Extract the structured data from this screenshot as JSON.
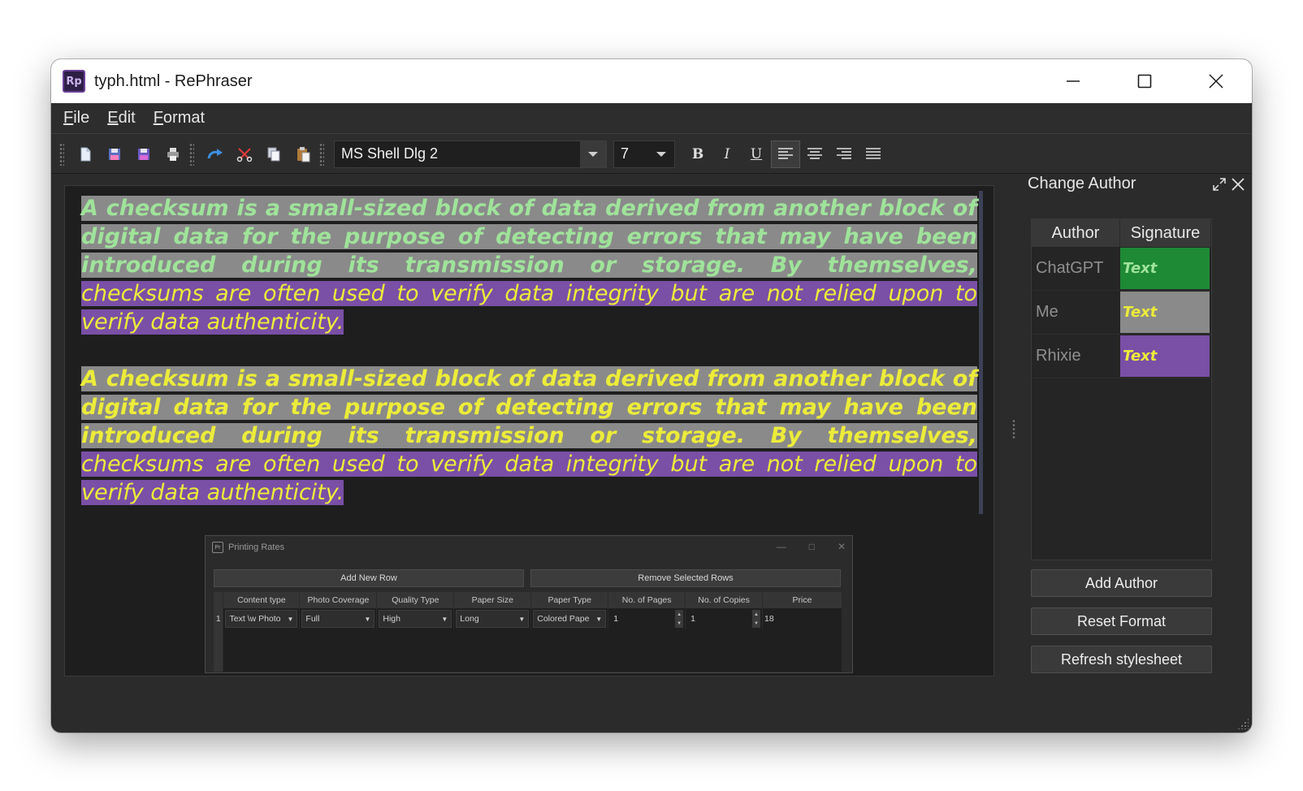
{
  "window": {
    "title": "typh.html - RePhraser",
    "app_icon": "Rp"
  },
  "menu": {
    "items": [
      {
        "mnemonic": "F",
        "rest": "ile"
      },
      {
        "mnemonic": "E",
        "rest": "dit"
      },
      {
        "mnemonic": "F",
        "rest": "ormat"
      }
    ]
  },
  "toolbar": {
    "font": "MS Shell Dlg 2",
    "size": "7",
    "bold": "B",
    "italic": "I",
    "underline": "U"
  },
  "document": {
    "paragraphs": [
      {
        "part_a": "A checksum is a small-sized block of data derived from another block of digital data for the purpose of detecting errors that may have been introduced during its transmission or storage. By themselves,",
        "part_b": "checksums are often used to verify data integrity but are not relied upon to verify data authenticity."
      },
      {
        "part_a": "A checksum is a small-sized block of data derived from another block of digital data for the purpose of detecting errors that may have been introduced during its transmission or storage. By themselves,",
        "part_b": "checksums are often used to verify data integrity but are not relied upon to verify data authenticity."
      }
    ]
  },
  "embedded": {
    "title": "Printing Rates",
    "icon": "Pr",
    "add_row": "Add New Row",
    "remove_rows": "Remove Selected Rows",
    "columns": [
      "Content type",
      "Photo Coverage",
      "Quality Type",
      "Paper Size",
      "Paper Type",
      "No. of Pages",
      "No. of Copies",
      "Price"
    ],
    "row": {
      "index": "1",
      "content_type": "Text \\w Photo",
      "photo_coverage": "Full",
      "quality_type": "High",
      "paper_size": "Long",
      "paper_type": "Colored Pape",
      "pages": "1",
      "copies": "1",
      "price": "18"
    }
  },
  "panel": {
    "title": "Change Author",
    "headers": [
      "Author",
      "Signature"
    ],
    "authors": [
      {
        "name": "ChatGPT",
        "sig": "Text",
        "sig_bg": "#1e8a35",
        "sig_color": "#9fe39a"
      },
      {
        "name": "Me",
        "sig": "Text",
        "sig_bg": "#8a8a8a",
        "sig_color": "#ecec3a"
      },
      {
        "name": "Rhixie",
        "sig": "Text",
        "sig_bg": "#7a4fa6",
        "sig_color": "#ecec3a"
      }
    ],
    "buttons": {
      "add_author": "Add Author",
      "reset_format": "Reset Format",
      "refresh": "Refresh stylesheet"
    }
  }
}
